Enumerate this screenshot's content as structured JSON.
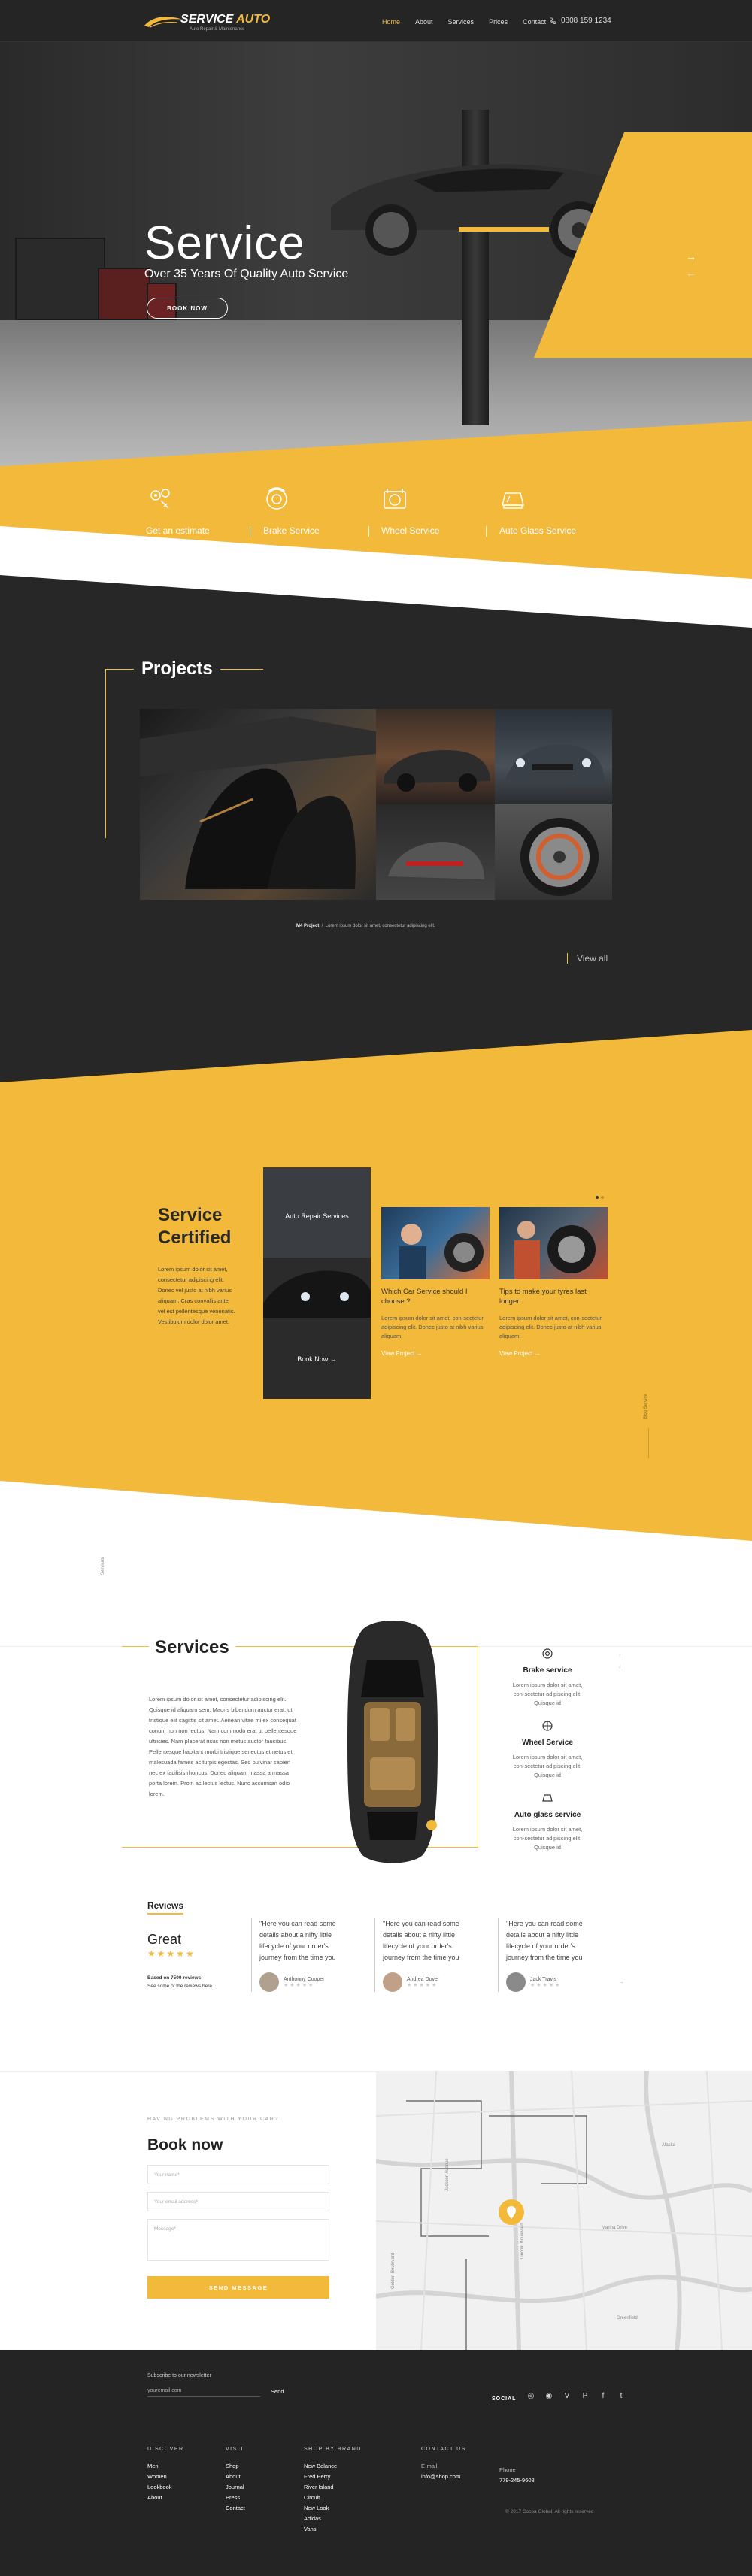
{
  "header": {
    "logo_main": "SERVICE",
    "logo_accent": "AUTO",
    "logo_tagline": "Auto Repair & Maintenance",
    "nav": [
      "Home",
      "About",
      "Services",
      "Prices",
      "Contact"
    ],
    "active": "Home",
    "phone": "0808 159 1234"
  },
  "hero": {
    "title": "Service",
    "subtitle": "Over 35 Years Of Quality Auto Service",
    "button": "BOOK NOW",
    "next_arrow": "→",
    "prev_arrow": "←"
  },
  "features": [
    {
      "label": "Get an estimate",
      "icon": "wrench-gear-icon"
    },
    {
      "label": "Brake Service",
      "icon": "brake-disc-icon"
    },
    {
      "label": "Wheel Service",
      "icon": "wheel-icon"
    },
    {
      "label": "Auto Glass Service",
      "icon": "windshield-icon"
    }
  ],
  "projects": {
    "title": "Projects",
    "caption_bold": "M4 Project",
    "caption_text": "Lorem ipsum dolor sit amet, consectetur adipiscing elit.",
    "view_all": "View all"
  },
  "certified": {
    "title_line1": "Service",
    "title_line2": "Certified",
    "text": "Lorem ipsum dolor sit amet, consectetur adipiscing elit. Donec vel justo at nibh varius aliquam. Cras convallis ante vel est pellentesque venenatis. Vestibulum dolor dolor amet.",
    "dark_card_title": "Auto Repair Services",
    "dark_card_button": "Book Now",
    "dark_card_arrow": "→",
    "cards": [
      {
        "title": "Which Car Service should I choose ?",
        "text": "Lorem ipsum dolor sit amet, con-sectetur adipiscing elit. Donec justo at nibh varius aliquam.",
        "link": "View Project",
        "arrow": "→"
      },
      {
        "title": "Tips to make your tyres last longer",
        "text": "Lorem ipsum dolor sit amet, con-sectetur adipiscing elit. Donec justo at nibh varius aliquam.",
        "link": "View Project",
        "arrow": "→"
      }
    ],
    "vertical_text": "Blog Service"
  },
  "services": {
    "vertical_text": "Services",
    "title": "Services",
    "text": "Lorem ipsum dolor sit amet, consectetur adipiscing elit. Quisque id aliquam sem. Mauris bibendum auctor erat, ut tristique elit sagittis sit amet. Aenean vitae mi ex consequat conum non non lectus. Nam commodo erat ut pellentesque ultricies. Nam placerat risus non metus auctor faucibus. Pellentesque habitant morbi tristique senectus et netus et malesuada fames ac turpis egestas. Sed pulvinar sapien nec ex facilisis rhoncus. Donec aliquam massa a massa porta lorem. Proin ac lectus lectus. Nunc accumsan odio lorem.",
    "items": [
      {
        "name": "Brake service",
        "text": "Lorem ipsum dolor sit amet, con-sectetur adipiscing elit. Quisque id",
        "icon": "brake-disc-icon"
      },
      {
        "name": "Wheel Service",
        "text": "Lorem ipsum dolor sit amet, con-sectetur adipiscing elit. Quisque id",
        "icon": "wheel-icon"
      },
      {
        "name": "Auto glass service",
        "text": "Lorem ipsum dolor sit amet, con-sectetur adipiscing elit. Quisque id",
        "icon": "windshield-icon"
      }
    ],
    "up_arrow": "↑",
    "down_arrow": "↓"
  },
  "reviews": {
    "heading": "Reviews",
    "rating_word": "Great",
    "stars": "★★★★★",
    "based_on": "Based on 7500 reviews",
    "see_some": "See some of the reviews here.",
    "next_arrow": "→",
    "items": [
      {
        "quote": "\"Here you can read some details about a nifty little lifecycle of your order's journey from the time you",
        "name": "Anthonny Cooper",
        "stars": "★★★★★"
      },
      {
        "quote": "\"Here you can read some details about a nifty little lifecycle of your order's journey from the time you",
        "name": "Andrea Dover",
        "stars": "★★★★★"
      },
      {
        "quote": "\"Here you can read some details about a nifty little lifecycle of your order's journey from the time you",
        "name": "Jack Travis",
        "stars": "★★★★★"
      }
    ]
  },
  "booking": {
    "kicker": "HAVING PROBLEMS WITH YOUR CAR?",
    "title": "Book now",
    "name_placeholder": "Your name*",
    "email_placeholder": "Your email address*",
    "message_placeholder": "Message*",
    "button": "SEND MESSAGE",
    "map_streets": [
      "Golden Boulevard",
      "Jackson Avenue",
      "Lincoln Boulevard",
      "Marina Drive",
      "Alaska",
      "Greenfield"
    ]
  },
  "footer": {
    "newsletter_label": "Subscribe to our newsletter",
    "newsletter_placeholder": "youremail.com",
    "newsletter_send": "Send",
    "social_label": "SOCIAL",
    "social_icons": [
      "◎",
      "◉",
      "V",
      "P",
      "f",
      "t"
    ],
    "columns": [
      {
        "heading": "DISCOVER",
        "items": [
          "Men",
          "Women",
          "Lookbook",
          "About"
        ]
      },
      {
        "heading": "VISIT",
        "items": [
          "Shop",
          "About",
          "Journal",
          "Press",
          "Contact"
        ]
      },
      {
        "heading": "SHOP BY BRAND",
        "items": [
          "New Balance",
          "Fred Perry",
          "River Island",
          "Circuit",
          "New Look",
          "Adidas",
          "Vans"
        ]
      }
    ],
    "contact_heading": "CONTACT US",
    "email_label": "E-mail",
    "email": "info@shop.com",
    "phone_label": "Phone",
    "phone": "779-245-9608",
    "copyright": "© 2017 Cocoa Global, All rights reserved"
  }
}
